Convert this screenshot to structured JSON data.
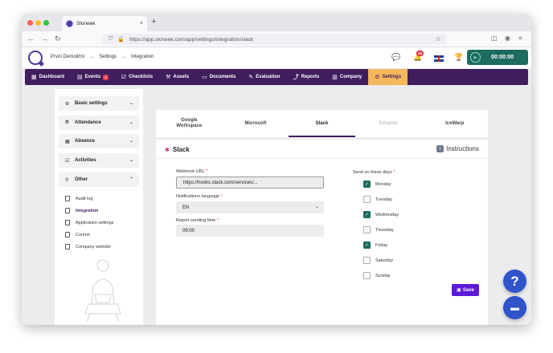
{
  "browser": {
    "tab_title": "Sloneek",
    "tab_close": "×",
    "new_tab": "+",
    "url": "https://app.sloneek.com/app/settings/integration/slack",
    "back": "←",
    "forward": "→",
    "reload": "↻",
    "shield": "⛉",
    "lock": "🔒",
    "star": "☆",
    "pocket": "◫",
    "account": "◉",
    "menu": "≡"
  },
  "header": {
    "breadcrumbs": [
      "První Demoliční",
      "Settings",
      "Integration"
    ],
    "breadcrumb_sep": "→",
    "notification_count": "44",
    "chat_icon": "💬",
    "bell_icon": "🔔",
    "trophy_icon": "🏆",
    "timer": "00:00:00",
    "play_icon": "▶"
  },
  "nav": {
    "items": [
      {
        "icon": "▦",
        "label": "Dashboard"
      },
      {
        "icon": "▤",
        "label": "Events",
        "count": "3"
      },
      {
        "icon": "☑",
        "label": "Checklists"
      },
      {
        "icon": "⚒",
        "label": "Assets"
      },
      {
        "icon": "▭",
        "label": "Documents"
      },
      {
        "icon": "✎",
        "label": "Evaluation"
      },
      {
        "icon": "⤴",
        "label": "Reports"
      },
      {
        "icon": "▥",
        "label": "Company"
      },
      {
        "icon": "⚙",
        "label": "Settings"
      }
    ]
  },
  "sidebar": {
    "sections": [
      {
        "icon": "⚙",
        "label": "Basic settings",
        "chev": "⌄"
      },
      {
        "icon": "⏱",
        "label": "Attendance",
        "chev": "⌄"
      },
      {
        "icon": "▦",
        "label": "Absence",
        "chev": "⌄"
      },
      {
        "icon": "☑",
        "label": "Activities",
        "chev": "⌄"
      },
      {
        "icon": "⚲",
        "label": "Other",
        "chev": "⌃"
      }
    ],
    "subitems": [
      "Audit log",
      "Integration",
      "Application settings",
      "Control",
      "Company website"
    ]
  },
  "integration_tabs": [
    "Google\nWorkspace",
    "Microsoft",
    "Slack",
    "Advanto",
    "IceWarp"
  ],
  "panel": {
    "title": "Slack",
    "slack_icon": "✱",
    "instructions_icon": "i",
    "instructions": "Instructions",
    "webhook_label": "Webhook URL",
    "webhook_value": "https://hooks.slack.com/services/...",
    "language_label": "Notifications language",
    "language_value": "EN",
    "dropdown_icon": "⌄",
    "time_label": "Report sending time",
    "time_value": "09:00",
    "required_mark": "*",
    "days_label": "Send on these days",
    "check_mark": "✓",
    "days": [
      {
        "label": "Monday",
        "checked": true
      },
      {
        "label": "Tuesday",
        "checked": false
      },
      {
        "label": "Wednesday",
        "checked": true
      },
      {
        "label": "Thursday",
        "checked": false
      },
      {
        "label": "Friday",
        "checked": true
      },
      {
        "label": "Saturday",
        "checked": false
      },
      {
        "label": "Sunday",
        "checked": false
      }
    ],
    "save_icon": "▣",
    "save_label": "Save"
  },
  "fab": {
    "help": "?",
    "chat": "▬"
  },
  "colors": {
    "nav_bg": "#3f1e5e",
    "nav_active": "#f4b75c",
    "timer_bg": "#1e6b5f",
    "checkbox_on": "#1e6b5f",
    "save_button": "#5a1ad6",
    "fab": "#2f53c9"
  }
}
